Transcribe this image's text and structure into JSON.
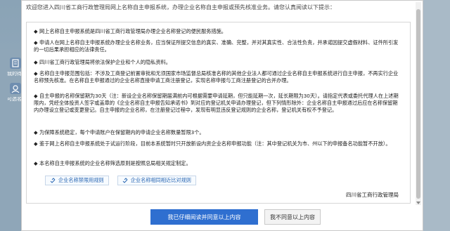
{
  "background": {
    "left_items": [
      "我的待办",
      "可选名称"
    ]
  },
  "modal": {
    "intro": "欢迎您进入四川省工商行政管理局网上名称自主申报系统，办理企业名称自主申报或预先核准业务。请您认真阅读以下提示：",
    "items": [
      "网上名称自主申报系统是四川省工商行政管理局办理企业名称登记的便民服务措施。",
      "申请人在网上名称自主申报系统办理企业名称业务，应当保证所提交信息的真实、准确、完整，并对其真实性、合法性负责，并承诺因提交虚假材料、证件所引发的一切后果承担相应的法律责任。",
      "四川省工商行政管理局将依法保护企业和个人的隐私资料。",
      "名称自主申报范围包括：不涉及工商登记前置审批和无须国家市场监督总局核准名称的其他企业法人都可通过企业名称自主申报系统进行自主申报，不再实行企业名称预先核准。在名称自主申报通过的企业名称直接申请工商注册登记，实现名称申报与工商注册登记的合并办理。",
      "自主申报的名称保留期为30天（注：新设企业名称保留期届满前内可根据需要申请延期，但只能延期一次，延长期限为30天）。请指定代表或委托代理人在上述期限内，凭经全体投资人签字或盖章的《企业名称自主申报告知承诺书》到对应的登记机关申请办理登记，但下列情形除外：企业名称自主申报通过后应在名称保留期内办理设立登记或变更登记。自主申报的企业名称，在注册登记过程中，发现有明显违反登记规则的企业名称，登记机关有权不予登记。",
      "为保障系统稳定，每个申请账户在保留期内的申请企业名称数量暂限3个。",
      "鉴于网上名称自主申报系统处于试运行阶段，目前本系统暂时只开放新设内资企业名称申报功能（注：其中登记机关为市、州以下的申报备名功能暂不开放）。",
      "本名称自主申报系统的企业名称筛选原则是按照总局相关规定制定。"
    ],
    "links": [
      "企业名称禁限用规则",
      "企业名称相同相近比对规则"
    ],
    "signature": "四川省工商行政管理局",
    "agree_label": "我已仔细阅读并同意以上内容",
    "disagree_label": "我不同意以上内容"
  },
  "colors": {
    "primary": "#2f6fd0",
    "link": "#2a67b3"
  }
}
